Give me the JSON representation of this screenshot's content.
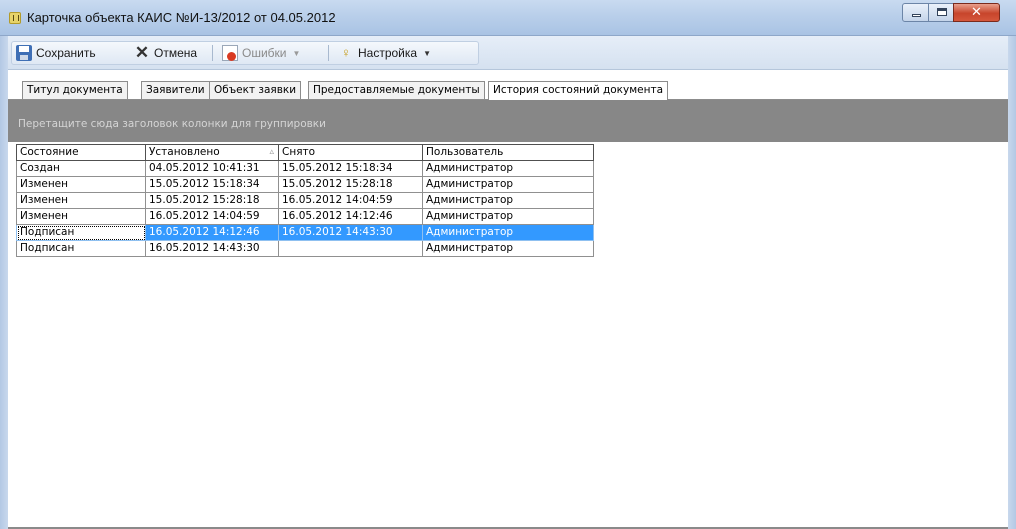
{
  "window": {
    "title": "Карточка объекта КАИС №И-13/2012 от 04.05.2012"
  },
  "toolbar": {
    "save_label": "Сохранить",
    "cancel_label": "Отмена",
    "errors_label": "Ошибки",
    "settings_label": "Настройка"
  },
  "tabs": [
    {
      "label": "Титул документа",
      "active": false
    },
    {
      "label": "Заявители",
      "active": false
    },
    {
      "label": "Объект заявки",
      "active": false
    },
    {
      "label": "Предоставляемые документы",
      "active": false
    },
    {
      "label": "История состояний документа",
      "active": true
    }
  ],
  "grid": {
    "group_hint": "Перетащите сюда заголовок колонки для группировки",
    "columns": [
      "Состояние",
      "Установлено",
      "Снято",
      "Пользователь"
    ],
    "sort_indicator": "▵",
    "rows": [
      [
        "Создан",
        "04.05.2012 10:41:31",
        "15.05.2012 15:18:34",
        "Администратор"
      ],
      [
        "Изменен",
        "15.05.2012 15:18:34",
        "15.05.2012 15:28:18",
        "Администратор"
      ],
      [
        "Изменен",
        "15.05.2012 15:28:18",
        "16.05.2012 14:04:59",
        "Администратор"
      ],
      [
        "Изменен",
        "16.05.2012 14:04:59",
        "16.05.2012 14:12:46",
        "Администратор"
      ],
      [
        "Подписан",
        "16.05.2012 14:12:46",
        "16.05.2012 14:43:30",
        "Администратор"
      ],
      [
        "Подписан",
        "16.05.2012 14:43:30",
        "",
        "Администратор"
      ]
    ],
    "selected_row": 4
  }
}
